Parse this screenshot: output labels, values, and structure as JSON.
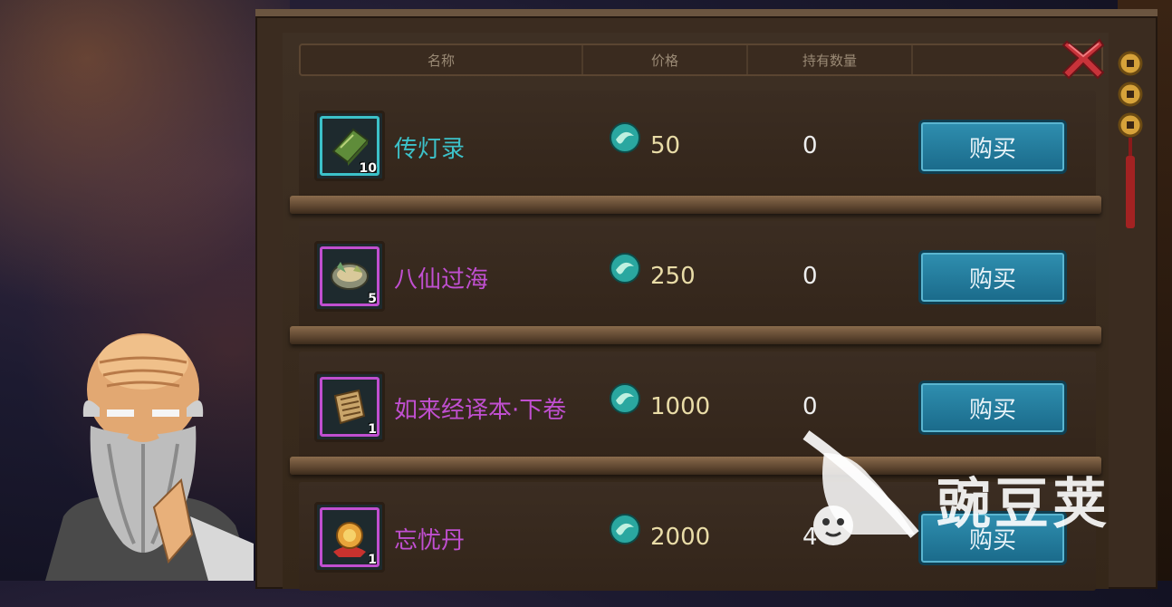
{
  "table": {
    "headers": [
      "名称",
      "价格",
      "持有数量"
    ]
  },
  "items": [
    {
      "name": "传灯录",
      "quality_color": "#3cc1c9",
      "stack": "10",
      "price": "50",
      "owned": "0",
      "buy_label": "购买",
      "icon": "green-book-icon"
    },
    {
      "name": "八仙过海",
      "quality_color": "#c04fd0",
      "stack": "5",
      "price": "250",
      "owned": "0",
      "buy_label": "购买",
      "icon": "bowl-icon"
    },
    {
      "name": "如来经译本·下卷",
      "quality_color": "#c04fd0",
      "stack": "1",
      "price": "1000",
      "owned": "0",
      "buy_label": "购买",
      "icon": "scroll-icon"
    },
    {
      "name": "忘忧丹",
      "quality_color": "#c04fd0",
      "stack": "1",
      "price": "2000",
      "owned": "4",
      "buy_label": "购买",
      "icon": "pill-icon"
    }
  ],
  "currency_icon": "jade-coin-icon",
  "watermark": {
    "text": "豌豆荚"
  },
  "colors": {
    "buy_button": "#1f7b9c",
    "teal_quality": "#3cc1c9",
    "purple_quality": "#c04fd0",
    "price_text": "#e9dca7"
  }
}
